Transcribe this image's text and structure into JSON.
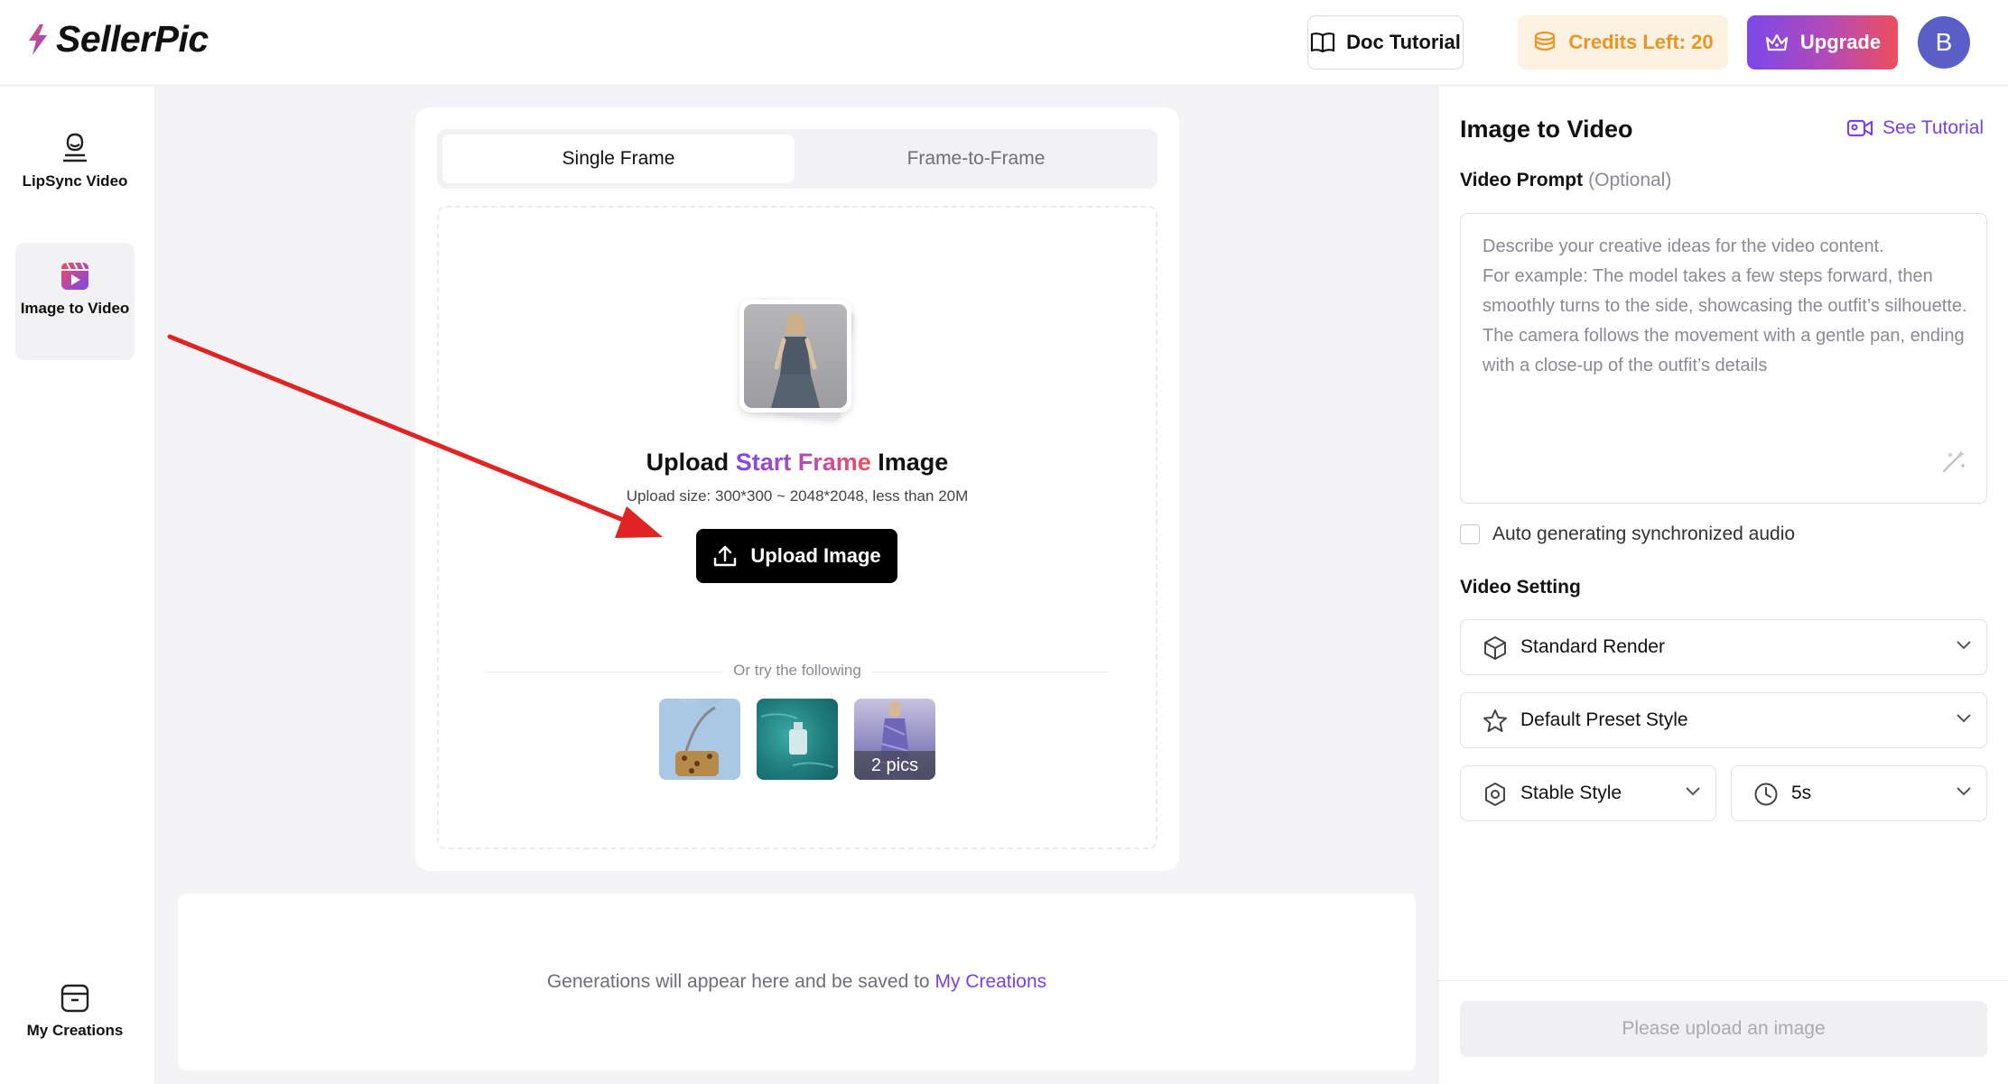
{
  "header": {
    "logo_text": "SellerPic",
    "doc_tutorial": "Doc Tutorial",
    "credits": "Credits Left: 20",
    "upgrade": "Upgrade",
    "avatar_initial": "B"
  },
  "sidebar": {
    "items": [
      {
        "label": "LipSync Video",
        "icon": "lipsync-icon"
      },
      {
        "label": "Image to Video",
        "icon": "image-to-video-icon"
      },
      {
        "label": "My Creations",
        "icon": "archive-icon"
      }
    ]
  },
  "upload": {
    "tabs": [
      "Single Frame",
      "Frame-to-Frame"
    ],
    "active_tab": "Single Frame",
    "title_prefix": "Upload",
    "title_highlight": "Start Frame",
    "title_suffix": "Image",
    "subtitle": "Upload size: 300*300 ~ 2048*2048, less than 20M",
    "button": "Upload Image",
    "try_label": "Or try the following",
    "sample_caption": "2 pics"
  },
  "generations": {
    "text": "Generations will appear here and be saved to",
    "link": "My Creations"
  },
  "panel": {
    "title": "Image to Video",
    "see_tutorial": "See Tutorial",
    "prompt_label": "Video Prompt",
    "prompt_optional": "(Optional)",
    "prompt_placeholder": "Describe your creative ideas for the video content.\nFor example: The model takes a few steps forward, then smoothly turns to the side, showcasing the outfit’s silhouette. The camera follows the movement with a gentle pan, ending with a close-up of the outfit’s details",
    "audio_label": "Auto generating synchronized audio",
    "audio_checked": false,
    "video_setting_label": "Video Setting",
    "render": "Standard Render",
    "preset": "Default Preset Style",
    "style": "Stable Style",
    "duration": "5s",
    "submit": "Please upload an image"
  },
  "colors": {
    "accent": "#7743e6",
    "credits_text": "#e99626",
    "arrow": "#e02424"
  }
}
